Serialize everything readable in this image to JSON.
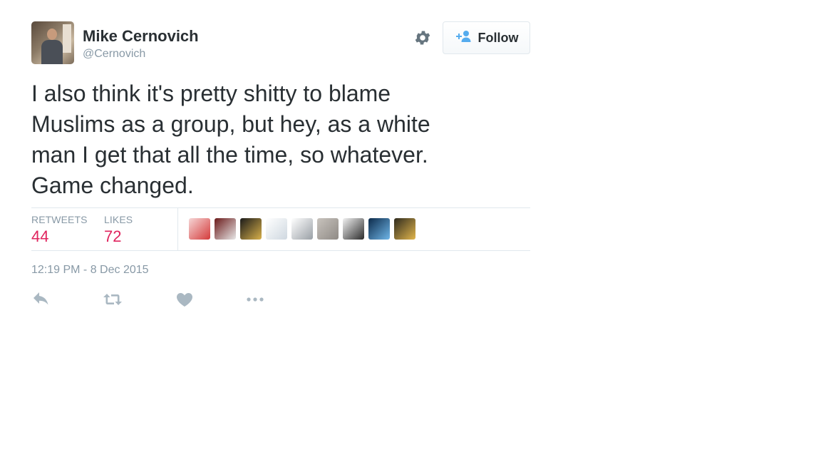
{
  "user": {
    "name": "Mike Cernovich",
    "handle": "@Cernovich"
  },
  "follow_button": {
    "label": "Follow",
    "icon": "add-person-icon"
  },
  "settings_icon": "gear-icon",
  "tweet": {
    "text": "I also think it's pretty shitty to blame\nMuslims as a group, but hey, as a white\nman I get that all the time, so whatever.\nGame changed.",
    "timestamp": "12:19 PM - 8 Dec 2015"
  },
  "stats": {
    "retweets_label": "RETWEETS",
    "retweets": "44",
    "likes_label": "LIKES",
    "likes": "72"
  },
  "likers": [
    {
      "name": "liker-avatar-1",
      "colors": [
        "#f6d6d6",
        "#d43b3b"
      ]
    },
    {
      "name": "liker-avatar-2",
      "colors": [
        "#6b1a1a",
        "#e8e8e8"
      ]
    },
    {
      "name": "liker-avatar-3",
      "colors": [
        "#1a1a1a",
        "#d8b04a"
      ]
    },
    {
      "name": "liker-avatar-4",
      "colors": [
        "#ffffff",
        "#cfd8e0"
      ]
    },
    {
      "name": "liker-avatar-5",
      "colors": [
        "#ffffff",
        "#9aa0a6"
      ]
    },
    {
      "name": "liker-avatar-6",
      "colors": [
        "#c8c3bd",
        "#8f8a85"
      ]
    },
    {
      "name": "liker-avatar-7",
      "colors": [
        "#f2f2f2",
        "#2b2b2b"
      ]
    },
    {
      "name": "liker-avatar-8",
      "colors": [
        "#0c2a4a",
        "#6fb6e8"
      ]
    },
    {
      "name": "liker-avatar-9",
      "colors": [
        "#2e2a1e",
        "#e2b64c"
      ]
    }
  ],
  "actions": [
    "reply-icon",
    "retweet-icon",
    "like-icon",
    "more-icon"
  ],
  "colors": {
    "like_count": "#e0245e",
    "muted": "#8899a6",
    "follow_accent": "#55acee"
  }
}
